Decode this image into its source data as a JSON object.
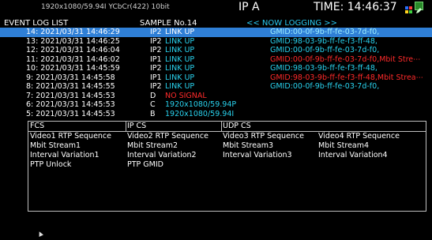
{
  "header": {
    "format": "1920x1080/59.94I YCbCr(422) 10bit",
    "ip_label": "IP A",
    "time": "TIME: 14:46:37"
  },
  "icons": {
    "status_icon_1": "multicolor-badge-icon",
    "status_icon_2": "green-edit-icon"
  },
  "log": {
    "title": "EVENT LOG LIST",
    "sample": "SAMPLE No.14",
    "status": "<< NOW LOGGING >>",
    "rows": [
      {
        "dt": "14: 2021/03/31 14:46:29",
        "port": "IP2",
        "event": "LINK UP",
        "event_color": "#ffffff",
        "detail": "GMID:00-0f-9b-ff-fe-03-7d-f0,",
        "detail_color": "#9ff0ff",
        "selected": true
      },
      {
        "dt": "13: 2021/03/31 14:46:25",
        "port": "IP2",
        "event": "LINK UP",
        "event_color": "#29d3ef",
        "detail": "GMID:98-03-9b-ff-fe-f3-ff-48,",
        "detail_color": "#29d3ef",
        "selected": false
      },
      {
        "dt": "12: 2021/03/31 14:46:04",
        "port": "IP2",
        "event": "LINK UP",
        "event_color": "#29d3ef",
        "detail": "GMID:00-0f-9b-ff-fe-03-7d-f0,",
        "detail_color": "#29d3ef",
        "selected": false
      },
      {
        "dt": "11: 2021/03/31 14:46:02",
        "port": "IP1",
        "event": "LINK UP",
        "event_color": "#29d3ef",
        "detail": "GMID:00-0f-9b-ff-fe-03-7d-f0,Mbit Stre⋯",
        "detail_color": "#ff2a2a",
        "selected": false
      },
      {
        "dt": "10: 2021/03/31 14:45:59",
        "port": "IP2",
        "event": "LINK UP",
        "event_color": "#29d3ef",
        "detail": "GMID:98-03-9b-ff-fe-f3-ff-48,",
        "detail_color": "#29d3ef",
        "selected": false
      },
      {
        "dt": "9: 2021/03/31 14:45:58",
        "port": "IP1",
        "event": "LINK UP",
        "event_color": "#29d3ef",
        "detail": "GMID:98-03-9b-ff-fe-f3-ff-48,Mbit Strea⋯",
        "detail_color": "#ff2a2a",
        "selected": false
      },
      {
        "dt": "8: 2021/03/31 14:45:55",
        "port": "IP2",
        "event": "LINK UP",
        "event_color": "#29d3ef",
        "detail": "GMID:00-0f-9b-ff-fe-03-7d-f0,",
        "detail_color": "#29d3ef",
        "selected": false
      },
      {
        "dt": "7: 2021/03/31 14:45:53",
        "port": "D",
        "event": "NO SIGNAL",
        "event_color": "#ff2a2a",
        "detail": "",
        "detail_color": "#ffffff",
        "selected": false
      },
      {
        "dt": "6: 2021/03/31 14:45:53",
        "port": "C",
        "event": "1920x1080/59.94P",
        "event_color": "#29d3ef",
        "detail": "",
        "detail_color": "#ffffff",
        "selected": false
      },
      {
        "dt": "5: 2021/03/31 14:45:53",
        "port": "B",
        "event": "1920x1080/59.94I",
        "event_color": "#29d3ef",
        "detail": "",
        "detail_color": "#ffffff",
        "selected": false
      }
    ]
  },
  "status_table": {
    "headers": [
      "FCS",
      "IP CS",
      "UDP CS",
      ""
    ],
    "rows": [
      [
        "Video1 RTP Sequence",
        "Video2 RTP Sequence",
        "Video3 RTP Sequence",
        "Video4 RTP Sequence"
      ],
      [
        "Mbit Stream1",
        "Mbit Stream2",
        "Mbit Stream3",
        "Mbit Stream4"
      ],
      [
        "Interval Variation1",
        "Interval Variation2",
        "Interval Variation3",
        "Interval Variation4"
      ],
      [
        "PTP Unlock",
        "PTP GMID",
        "",
        ""
      ]
    ]
  }
}
